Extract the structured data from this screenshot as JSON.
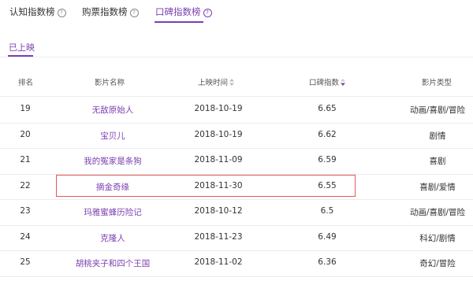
{
  "tabs": [
    {
      "label": "认知指数榜",
      "help": "?"
    },
    {
      "label": "购票指数榜",
      "help": "?"
    },
    {
      "label": "口碑指数榜",
      "help": "?"
    }
  ],
  "subtab": {
    "label": "已上映"
  },
  "table": {
    "headers": {
      "rank": "排名",
      "name": "影片名称",
      "date": "上映时间",
      "score": "口碑指数",
      "genre": "影片类型"
    },
    "rows": [
      {
        "rank": "19",
        "name": "无敌原始人",
        "date": "2018-10-19",
        "score": "6.65",
        "genre": "动画/喜剧/冒险"
      },
      {
        "rank": "20",
        "name": "宝贝儿",
        "date": "2018-10-19",
        "score": "6.62",
        "genre": "剧情"
      },
      {
        "rank": "21",
        "name": "我的冤家是条狗",
        "date": "2018-11-09",
        "score": "6.59",
        "genre": "喜剧"
      },
      {
        "rank": "22",
        "name": "摘金奇缘",
        "date": "2018-11-30",
        "score": "6.55",
        "genre": "喜剧/爱情"
      },
      {
        "rank": "23",
        "name": "玛雅蜜蜂历险记",
        "date": "2018-10-12",
        "score": "6.5",
        "genre": "动画/喜剧/冒险"
      },
      {
        "rank": "24",
        "name": "克隆人",
        "date": "2018-11-23",
        "score": "6.49",
        "genre": "科幻/剧情"
      },
      {
        "rank": "25",
        "name": "胡桃夹子和四个王国",
        "date": "2018-11-02",
        "score": "6.36",
        "genre": "奇幻/冒险"
      }
    ]
  },
  "colors": {
    "accent": "#7b3fb1",
    "highlight_border": "#e05a5a",
    "sort_inactive": "#bbbbbb"
  }
}
